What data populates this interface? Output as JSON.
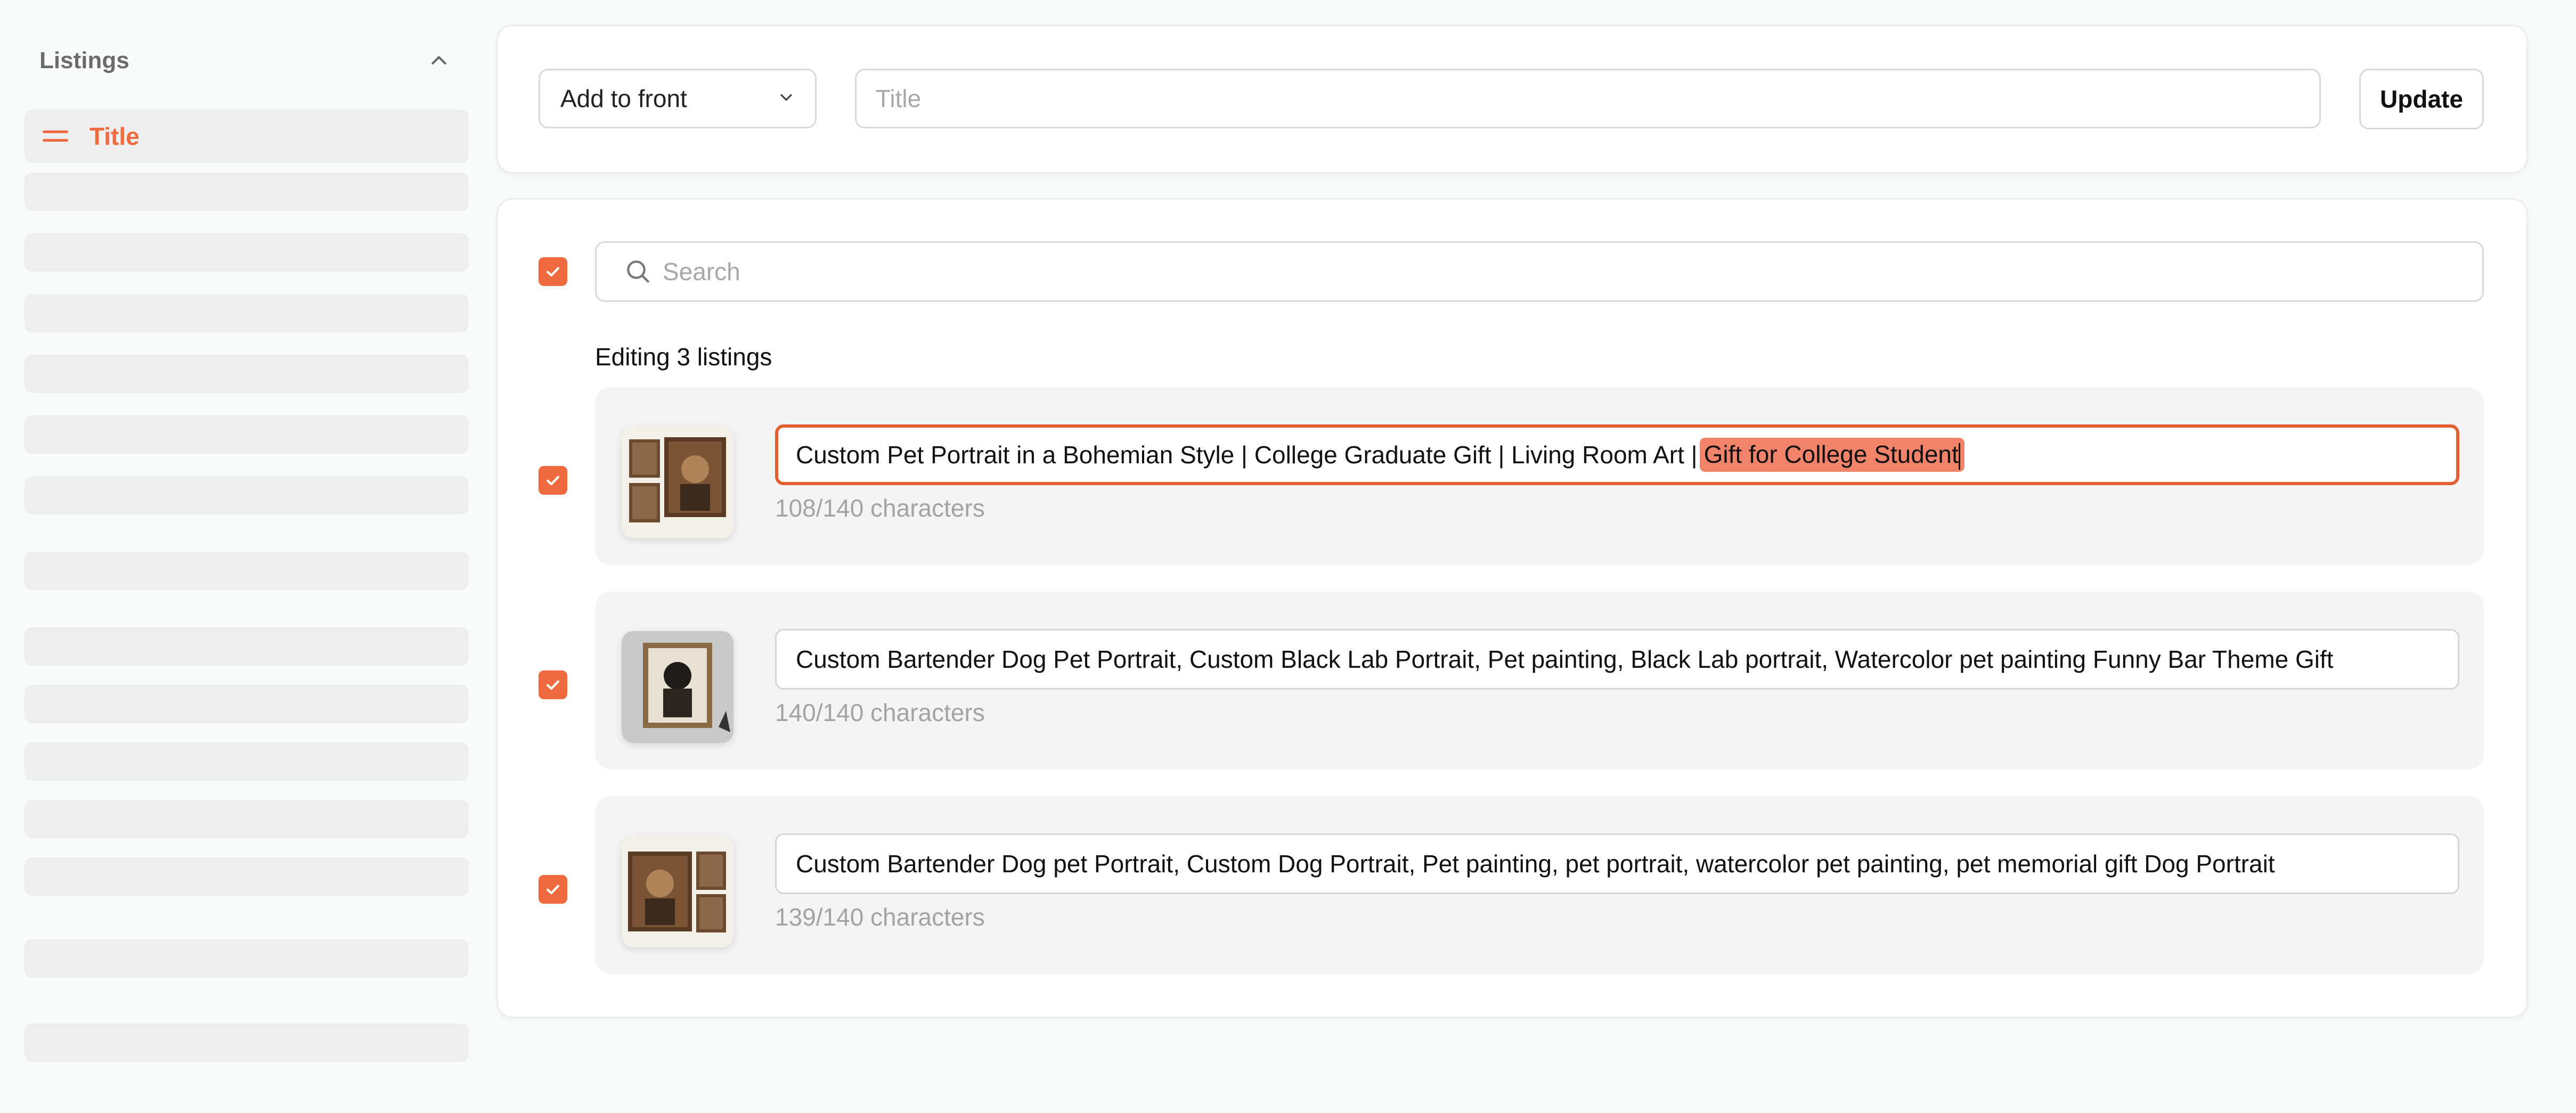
{
  "sidebar": {
    "title": "Listings",
    "active_item": "Title"
  },
  "toolbar": {
    "position_select": "Add to front",
    "title_placeholder": "Title",
    "update_label": "Update"
  },
  "search": {
    "placeholder": "Search"
  },
  "editing_label": "Editing 3 listings",
  "listings": [
    {
      "title_prefix": "Custom Pet Portrait in a Bohemian Style | College Graduate Gift | Living Room Art |",
      "title_highlight": "Gift for College Student",
      "count": "108/140 characters"
    },
    {
      "title": "Custom Bartender Dog Pet Portrait, Custom Black Lab Portrait, Pet painting, Black Lab portrait, Watercolor pet painting Funny Bar Theme Gift",
      "count": "140/140 characters"
    },
    {
      "title": "Custom Bartender Dog pet Portrait, Custom Dog Portrait, Pet painting, pet portrait, watercolor pet painting, pet memorial gift Dog Portrait",
      "count": "139/140 characters"
    }
  ],
  "colors": {
    "accent": "#ef6a3f",
    "highlight": "#f2836b",
    "muted_text": "#a3a3a3",
    "placeholder_bg": "#efeeee"
  },
  "icons": [
    "chevron-up-icon",
    "drag-handle-icon",
    "chevron-down-icon",
    "search-icon",
    "checkmark-icon"
  ]
}
